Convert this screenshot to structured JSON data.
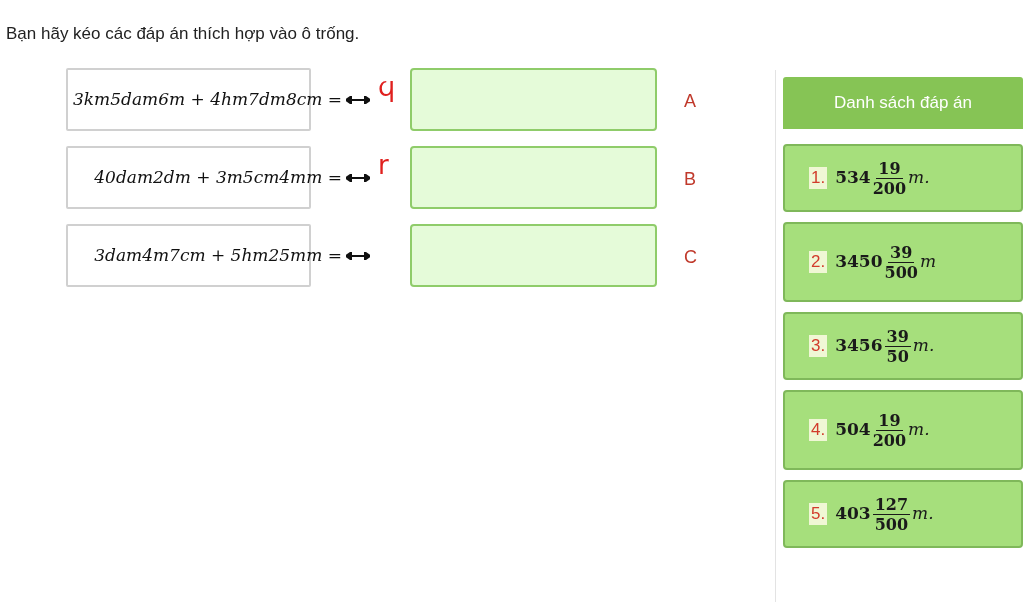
{
  "instruction": "Bạn hãy kéo các đáp án thích hợp vào ô trống.",
  "rows": [
    {
      "expression": "3km5dam6m + 4hm7dm8cm =",
      "mark": "ϥ",
      "letter": "A"
    },
    {
      "expression": "40dam2dm + 3m5cm4mm =",
      "mark": "r",
      "letter": "B"
    },
    {
      "expression": "3dam4m7cm + 5hm25mm =",
      "letter": "C"
    }
  ],
  "answers_panel": {
    "title": "Danh sách đáp án",
    "answers": [
      {
        "number": "1.",
        "whole": "534",
        "numerator": "19",
        "denominator": "200",
        "unit": "m."
      },
      {
        "number": "2.",
        "whole": "3450",
        "numerator": "39",
        "denominator": "500",
        "unit": "m"
      },
      {
        "number": "3.",
        "whole": "3456",
        "numerator": "39",
        "denominator": "50",
        "unit": "m."
      },
      {
        "number": "4.",
        "whole": "504",
        "numerator": "19",
        "denominator": "200",
        "unit": "m."
      },
      {
        "number": "5.",
        "whole": "403",
        "numerator": "127",
        "denominator": "500",
        "unit": "m."
      }
    ]
  }
}
